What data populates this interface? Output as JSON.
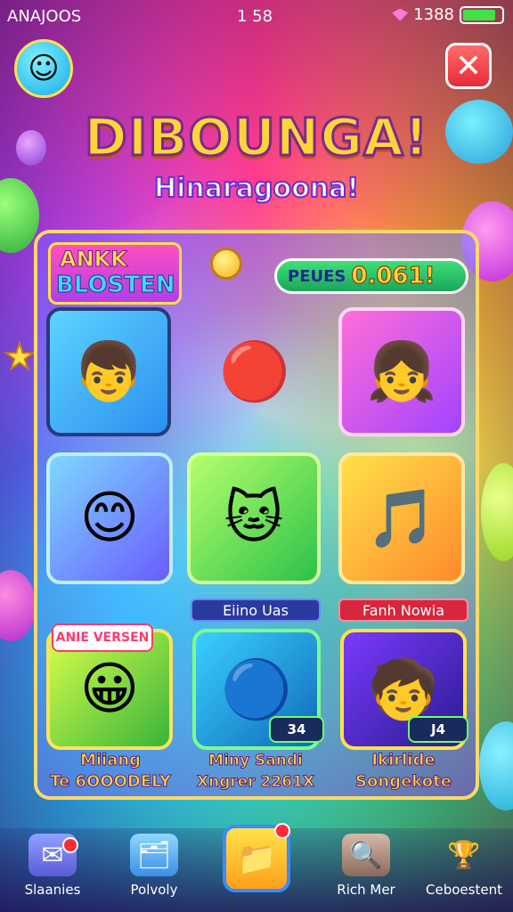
{
  "status_bar": {
    "carrier": "ANAJOOS",
    "time": "1 58",
    "battery_text": "1388",
    "battery_level": 0.85,
    "battery_color": "#43e04a"
  },
  "header": {
    "mascot_icon": "smiley-ball-icon",
    "close_icon": "close-icon",
    "title": "DIBOUNGA!",
    "subtitle": "Hinaragoona!"
  },
  "panel": {
    "badge_line1": "ANKK",
    "badge_line2": "BLOSTEN",
    "score_label": "PEUES",
    "score_value": "0.061!",
    "tiles": [
      {
        "icon": "boy-character-icon"
      },
      {
        "icon": "red-ball-character-icon"
      },
      {
        "icon": "purple-hair-girl-icon"
      },
      {
        "icon": "yellow-ball-character-icon"
      },
      {
        "icon": "cat-coin-character-icon"
      },
      {
        "icon": "music-hat-character-icon"
      },
      {
        "icon": "yellow-coin-character-icon"
      },
      {
        "icon": "blue-blob-character-icon"
      },
      {
        "icon": "orange-hair-boy-icon"
      }
    ],
    "label_a": "Eiino Uas",
    "label_b": "Fanh Nowia",
    "tag_new": "ANIE VERSEN",
    "mini_badge_1": "34",
    "mini_badge_2": "J4",
    "caption_1_line1": "Miiang",
    "caption_1_line2": "Te 6OOODELY",
    "caption_2_line1": "Miny Sandi",
    "caption_2_line2": "Xngrer 2261X",
    "caption_3_line1": "Ikirlide",
    "caption_3_line2": "Songekote"
  },
  "bottom_nav": {
    "items": [
      {
        "label": "Slaanies",
        "icon": "mail-icon"
      },
      {
        "label": "Polvoly",
        "icon": "folder-icon"
      },
      {
        "label": "",
        "icon": "home-folder-icon"
      },
      {
        "label": "Rich Mer",
        "icon": "profile-icon"
      },
      {
        "label": "Ceboestent",
        "icon": "trophy-icon"
      }
    ]
  }
}
